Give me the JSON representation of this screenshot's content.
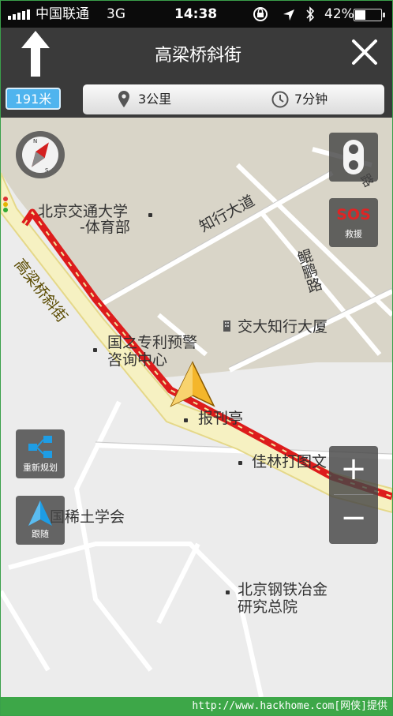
{
  "status_bar": {
    "carrier": "中国联通",
    "network": "3G",
    "time": "14:38",
    "battery": "42%",
    "battery_level": 0.42,
    "icons": [
      "signal-icon",
      "rotation-lock-icon",
      "location-icon",
      "bluetooth-icon",
      "battery-icon"
    ]
  },
  "header": {
    "next_street": "高梁桥斜街",
    "direction_icon": "straight-arrow-icon",
    "close_icon": "close-icon"
  },
  "info_bar": {
    "distance_to_turn": "191米",
    "remaining_distance": "3公里",
    "remaining_time": "7分钟",
    "icons": [
      "location-pin-icon",
      "clock-icon"
    ]
  },
  "map": {
    "labels": {
      "poi_bjtu_sports_1": "北京交通大学",
      "poi_bjtu_sports_2": "-体育部",
      "road_zhixing": "知行大道",
      "road_kunpeng": "鲲鹏路",
      "road_small": "路",
      "poi_jiaoda_building": "交大知行大厦",
      "poi_patent_1": "国之专利预警",
      "poi_patent_2": "咨询中心",
      "road_gaoliangqiao": "高梁桥斜街",
      "poi_newsstand": "报刊亭",
      "poi_jialin": "佳林打图文",
      "poi_rare_earth": "国稀土学会",
      "poi_steel_1": "北京钢铁冶金",
      "poi_steel_2": "研究总院"
    },
    "colors": {
      "campus": "#d9d5c8",
      "route": "#dd1c1c",
      "route_casing": "#f2e6a0",
      "road": "#ffffff"
    }
  },
  "controls": {
    "compass_icon": "compass-icon",
    "traffic_icon": "traffic-light-icon",
    "sos_label": "SOS",
    "sos_caption": "救援",
    "reroute_caption": "重新规划",
    "follow_caption": "跟随",
    "zoom_in": "+",
    "zoom_out": "−"
  },
  "footer": {
    "watermark": "http://www.hackhome.com[网侠]提供"
  }
}
